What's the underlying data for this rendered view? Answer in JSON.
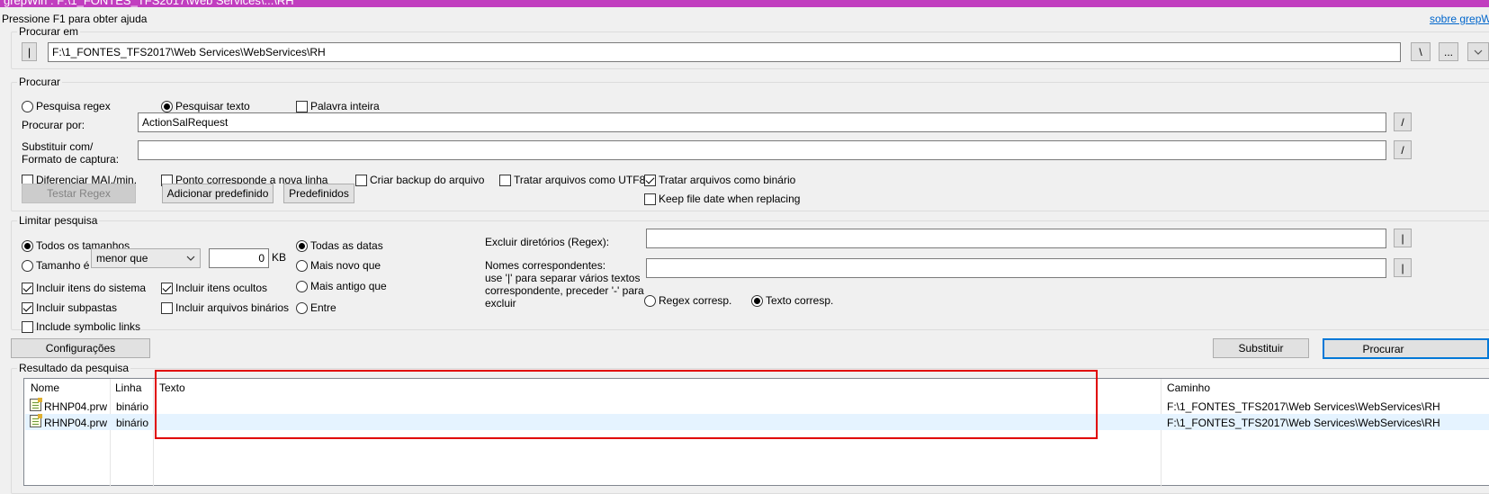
{
  "titlebar": {
    "title": "grepWin : F:\\1_FONTES_TFS2017\\Web Services\\...\\RH"
  },
  "help_text": "Pressione F1 para obter ajuda",
  "about_link": "sobre grepW",
  "search_in": {
    "legend": "Procurar em",
    "left_button": "|",
    "path": "F:\\1_FONTES_TFS2017\\Web Services\\WebServices\\RH",
    "backslash_button": "\\",
    "browse_button": "...",
    "dropdown_icon": "chevron-down-icon"
  },
  "search": {
    "legend": "Procurar",
    "regex_radio": "Pesquisa regex",
    "text_radio": "Pesquisar texto",
    "whole_word": "Palavra inteira",
    "search_for_label": "Procurar por:",
    "search_for_value": "ActionSalRequest",
    "replace_label_1": "Substituir com/",
    "replace_label_2": "Formato de captura:",
    "replace_value": "",
    "slash_button": "/",
    "case_sensitive": "Diferenciar MAI./min.",
    "dot_newline": "Ponto corresponde a nova linha",
    "backup": "Criar backup do arquivo",
    "utf8": "Tratar arquivos como UTF8",
    "binary": "Tratar arquivos como binário",
    "keep_date": "Keep file date when replacing",
    "test_regex_button": "Testar Regex",
    "add_preset_button": "Adicionar predefinido",
    "presets_button": "Predefinidos"
  },
  "limit": {
    "legend": "Limitar pesquisa",
    "all_sizes": "Todos os tamanhos",
    "size_is": "Tamanho é",
    "size_op": "menor que",
    "size_value": "0",
    "size_unit": "KB",
    "all_dates": "Todas as datas",
    "newer": "Mais novo que",
    "older": "Mais antigo que",
    "between": "Entre",
    "system_items": "Incluir itens do sistema",
    "hidden_items": "Incluir itens ocultos",
    "subfolders": "Incluir subpastas",
    "binary_files": "Incluir arquivos binários",
    "symlinks": "Include symbolic links",
    "exclude_dirs_label": "Excluir diretórios (Regex):",
    "exclude_dirs_value": "",
    "names_label_1": "Nomes correspondentes:",
    "names_label_2": "use '|' para separar vários textos",
    "names_label_3": "correspondente, preceder '-' para",
    "names_label_4": "excluir",
    "names_value": "",
    "regex_match": "Regex corresp.",
    "text_match": "Texto corresp.",
    "pipe_button": "|"
  },
  "actions": {
    "settings_button": "Configurações",
    "replace_button": "Substituir",
    "search_button": "Procurar"
  },
  "results": {
    "legend": "Resultado da pesquisa",
    "columns": {
      "name": "Nome",
      "line": "Linha",
      "text": "Texto",
      "path": "Caminho"
    },
    "rows": [
      {
        "name": "RHNP04.prw",
        "line": "binário",
        "text": "",
        "path": "F:\\1_FONTES_TFS2017\\Web Services\\WebServices\\RH"
      },
      {
        "name": "RHNP04.prw",
        "line": "binário",
        "text": "",
        "path": "F:\\1_FONTES_TFS2017\\Web Services\\WebServices\\RH"
      }
    ]
  },
  "colors": {
    "titlebar": "#c13ebf",
    "highlight_box": "#e00000",
    "selected_row": "#e5f3ff",
    "link": "#0066cc"
  }
}
